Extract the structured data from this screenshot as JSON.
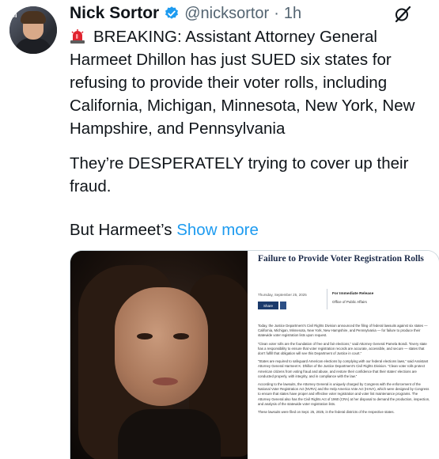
{
  "author": {
    "name": "Nick Sortor",
    "handle": "@nicksortor",
    "separator": "·",
    "time": "1h",
    "avatar_tag": "SI"
  },
  "tweet": {
    "paragraph_1": "BREAKING: Assistant Attorney General Harmeet Dhillon has just SUED six states for refusing to provide their voter rolls, including California, Michigan, Minnesota, New York, New Hampshire, and Pennsylvania",
    "paragraph_2": "They’re DESPERATELY trying to cover up their fraud.",
    "paragraph_3": "But Harmeet’s",
    "show_more": "Show more"
  },
  "document": {
    "title": "Failure to Provide Voter Registration Rolls",
    "date": "Thursday, September 25, 2025",
    "share_label": "Share",
    "release_title": "For Immediate Release",
    "release_office": "Office of Public Affairs",
    "paragraphs": [
      "Today, the Justice Department’s Civil Rights Division announced the filing of federal lawsuits against six states — California, Michigan, Minnesota, New York, New Hampshire, and Pennsylvania — for failure to produce their statewide voter registration lists upon request.",
      "“Clean voter rolls are the foundation of free and fair elections,” said Attorney General Pamela Bondi. “Every state has a responsibility to ensure that voter registration records are accurate, accessible, and secure — states that don’t fulfill that obligation will see this Department of Justice in court.”",
      "“States are required to safeguard American elections by complying with our federal elections laws,” said Assistant Attorney General Harmeet K. Dhillon of the Justice Department’s Civil Rights Division. “Clean voter rolls protect American citizens from voting fraud and abuse, and restore their confidence that their states’ elections are conducted properly, with integrity, and in compliance with the law.”",
      "According to the lawsuits, the Attorney General is uniquely charged by Congress with the enforcement of the National Voter Registration Act (NVRA) and the Help America Vote Act (HAVA), which were designed by Congress to ensure that states have proper and effective voter registration and voter list maintenance programs. The Attorney General also has the Civil Rights Act of 1960 (CRA) at her disposal to demand the production, inspection, and analysis of the statewide voter registration lists.",
      "These lawsuits were filed on Sept. 25, 2025, in the federal districts of the respective states."
    ]
  },
  "icons": {
    "verified": "verified-badge-icon",
    "grok": "grok-icon",
    "siren": "siren-emoji-icon"
  },
  "colors": {
    "link": "#1d9bf0",
    "verified": "#1d9bf0",
    "text": "#0f1419",
    "muted": "#536471",
    "doc_title": "#1b2a49"
  }
}
